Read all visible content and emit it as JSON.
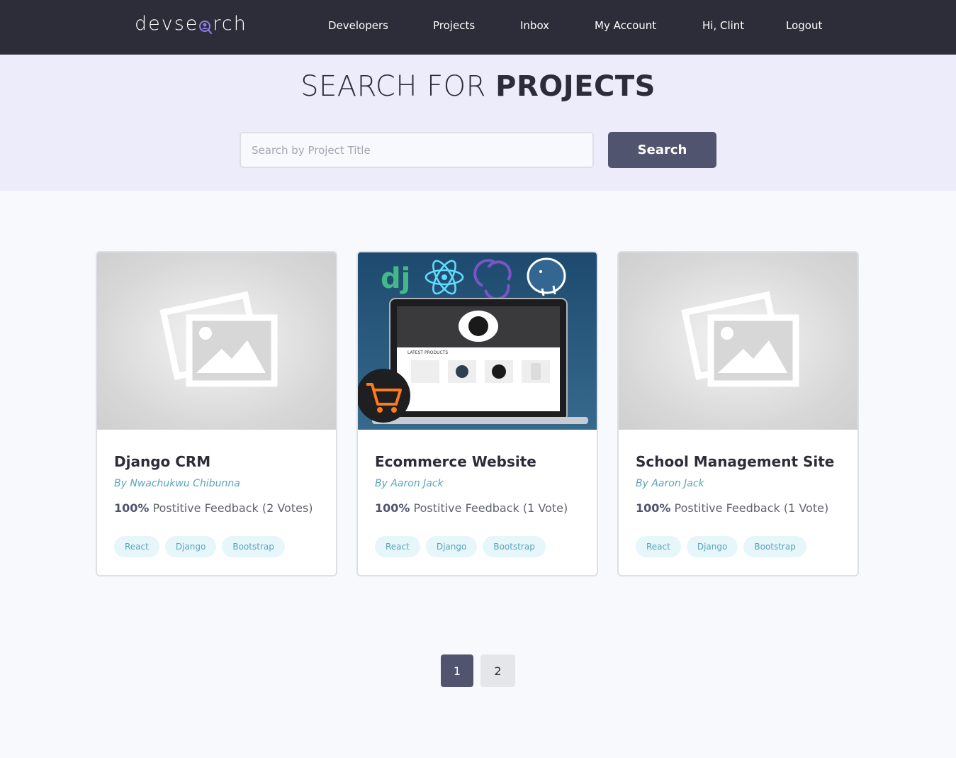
{
  "header": {
    "logo_left": "devse",
    "logo_right": "rch",
    "nav": [
      {
        "label": "Developers"
      },
      {
        "label": "Projects"
      },
      {
        "label": "Inbox"
      },
      {
        "label": "My Account"
      },
      {
        "label": "Hi, Clint"
      },
      {
        "label": "Logout"
      }
    ]
  },
  "hero": {
    "title_light": "SEARCH FOR ",
    "title_bold": "PROJECTS",
    "search_placeholder": "Search by Project Title",
    "search_value": "",
    "search_button": "Search"
  },
  "projects": [
    {
      "title": "Django CRM",
      "author": "By Nwachukwu Chibunna",
      "feedback_pct": "100%",
      "feedback_text": " Postitive Feedback (2 Votes)",
      "tags": [
        "React",
        "Django",
        "Bootstrap"
      ],
      "image": "placeholder-image-icon"
    },
    {
      "title": "Ecommerce Website",
      "author": "By Aaron Jack",
      "feedback_pct": "100%",
      "feedback_text": " Postitive Feedback (1 Vote)",
      "tags": [
        "React",
        "Django",
        "Bootstrap"
      ],
      "image": "ecommerce-screenshot",
      "image_text": {
        "dj": "dj",
        "latest": "LATEST PRODUCTS"
      }
    },
    {
      "title": "School Management Site",
      "author": "By Aaron Jack",
      "feedback_pct": "100%",
      "feedback_text": " Postitive Feedback (1 Vote)",
      "tags": [
        "React",
        "Django",
        "Bootstrap"
      ],
      "image": "placeholder-image-icon"
    }
  ],
  "pagination": {
    "pages": [
      "1",
      "2"
    ],
    "current": "1"
  },
  "colors": {
    "header_bg": "#2d2d39",
    "hero_bg": "#ececfb",
    "accent": "#51546e",
    "tag_bg": "#e6f6fb",
    "tag_text": "#5aa5b9"
  }
}
